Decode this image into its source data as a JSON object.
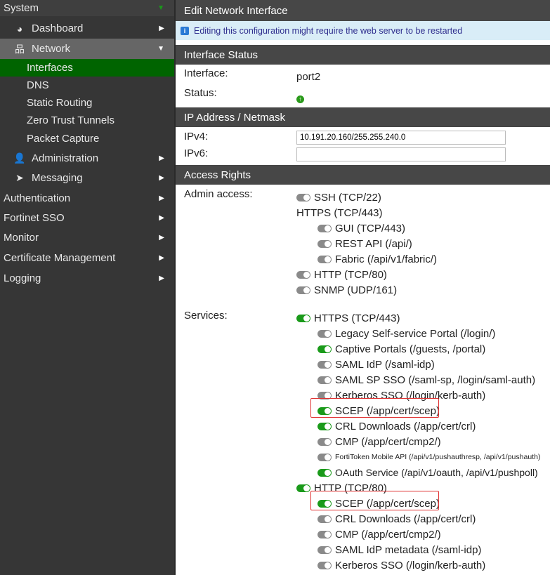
{
  "sidebar": {
    "system": "System",
    "dashboard": "Dashboard",
    "network": "Network",
    "network_items": [
      "Interfaces",
      "DNS",
      "Static Routing",
      "Zero Trust Tunnels",
      "Packet Capture"
    ],
    "administration": "Administration",
    "messaging": "Messaging",
    "top_items": [
      "Authentication",
      "Fortinet SSO",
      "Monitor",
      "Certificate Management",
      "Logging"
    ]
  },
  "main": {
    "title": "Edit Network Interface",
    "info": "Editing this configuration might require the web server to be restarted",
    "interface_status": {
      "header": "Interface Status",
      "interface_label": "Interface:",
      "interface_value": "port2",
      "status_label": "Status:"
    },
    "ip": {
      "header": "IP Address / Netmask",
      "ipv4_label": "IPv4:",
      "ipv4_value": "10.191.20.160/255.255.240.0",
      "ipv6_label": "IPv6:",
      "ipv6_value": ""
    },
    "access": {
      "header": "Access Rights",
      "admin_label": "Admin access:",
      "services_label": "Services:",
      "admin": [
        {
          "label": "SSH (TCP/22)",
          "level": 0,
          "toggle": "off"
        },
        {
          "label": "HTTPS (TCP/443)",
          "level": 0,
          "toggle": "none"
        },
        {
          "label": "GUI (TCP/443)",
          "level": 1,
          "toggle": "off"
        },
        {
          "label": "REST API (/api/)",
          "level": 1,
          "toggle": "off"
        },
        {
          "label": "Fabric (/api/v1/fabric/)",
          "level": 1,
          "toggle": "off"
        },
        {
          "label": "HTTP (TCP/80)",
          "level": 0,
          "toggle": "off"
        },
        {
          "label": "SNMP (UDP/161)",
          "level": 0,
          "toggle": "off"
        }
      ],
      "services": [
        {
          "label": "HTTPS (TCP/443)",
          "level": 0,
          "toggle": "on"
        },
        {
          "label": "Legacy Self-service Portal (/login/)",
          "level": 1,
          "toggle": "off"
        },
        {
          "label": "Captive Portals (/guests, /portal)",
          "level": 1,
          "toggle": "on"
        },
        {
          "label": "SAML IdP (/saml-idp)",
          "level": 1,
          "toggle": "off"
        },
        {
          "label": "SAML SP SSO (/saml-sp, /login/saml-auth)",
          "level": 1,
          "toggle": "off"
        },
        {
          "label": "Kerberos SSO (/login/kerb-auth)",
          "level": 1,
          "toggle": "off"
        },
        {
          "label": "SCEP (/app/cert/scep)",
          "level": 1,
          "toggle": "on",
          "highlight": true
        },
        {
          "label": "CRL Downloads (/app/cert/crl)",
          "level": 1,
          "toggle": "on"
        },
        {
          "label": "CMP (/app/cert/cmp2/)",
          "level": 1,
          "toggle": "off"
        },
        {
          "label": "FortiToken Mobile API (/api/v1/pushauthresp, /api/v1/pushauth)",
          "level": 1,
          "toggle": "off"
        },
        {
          "label": "OAuth Service (/api/v1/oauth, /api/v1/pushpoll)",
          "level": 1,
          "toggle": "on"
        },
        {
          "label": "HTTP (TCP/80)",
          "level": 0,
          "toggle": "on"
        },
        {
          "label": "SCEP (/app/cert/scep)",
          "level": 1,
          "toggle": "on",
          "highlight": true
        },
        {
          "label": "CRL Downloads (/app/cert/crl)",
          "level": 1,
          "toggle": "off"
        },
        {
          "label": "CMP (/app/cert/cmp2/)",
          "level": 1,
          "toggle": "off"
        },
        {
          "label": "SAML IdP metadata (/saml-idp)",
          "level": 1,
          "toggle": "off"
        },
        {
          "label": "Kerberos SSO (/login/kerb-auth)",
          "level": 1,
          "toggle": "off"
        }
      ]
    }
  }
}
